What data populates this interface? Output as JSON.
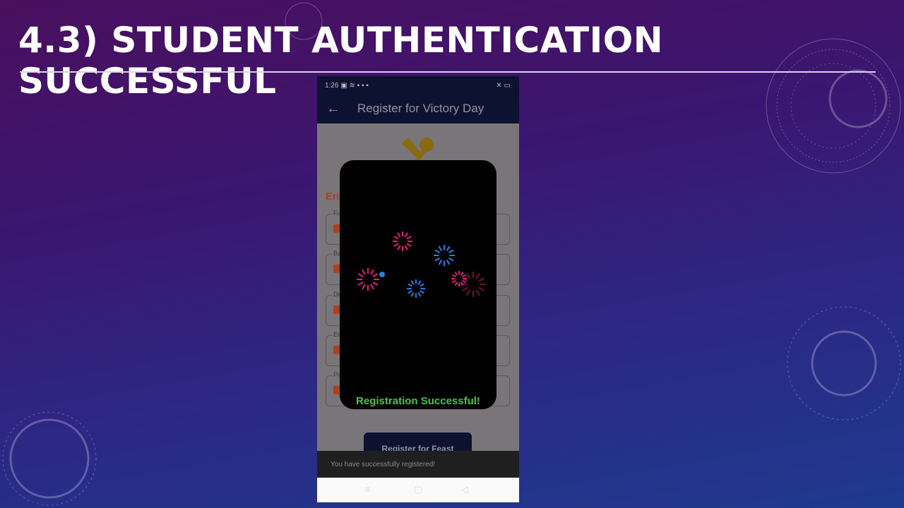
{
  "slide": {
    "title": "4.3) STUDENT AUTHENTICATION SUCCESSFUL"
  },
  "phone": {
    "status": {
      "time": "1:26"
    },
    "appbar": {
      "back_icon": "arrow-left-icon",
      "title": "Register for Victory Day"
    },
    "form": {
      "heading": "Ent",
      "fields": [
        {
          "label": "Fu"
        },
        {
          "label": "Ba"
        },
        {
          "label": "De"
        },
        {
          "label": "Er"
        },
        {
          "label": "Pa"
        }
      ]
    },
    "submit_label": "Register for Feast",
    "dialog": {
      "message": "Registration Successful!"
    },
    "snackbar": "You have successfully registered!",
    "nav": {
      "menu": "≡",
      "home": "▢",
      "back": "◁"
    }
  },
  "colors": {
    "accent": "#a9421f",
    "success": "#4fc34f",
    "appbar": "#0d1230",
    "firework_pink": "#e0207a",
    "firework_blue": "#2a7de0"
  }
}
